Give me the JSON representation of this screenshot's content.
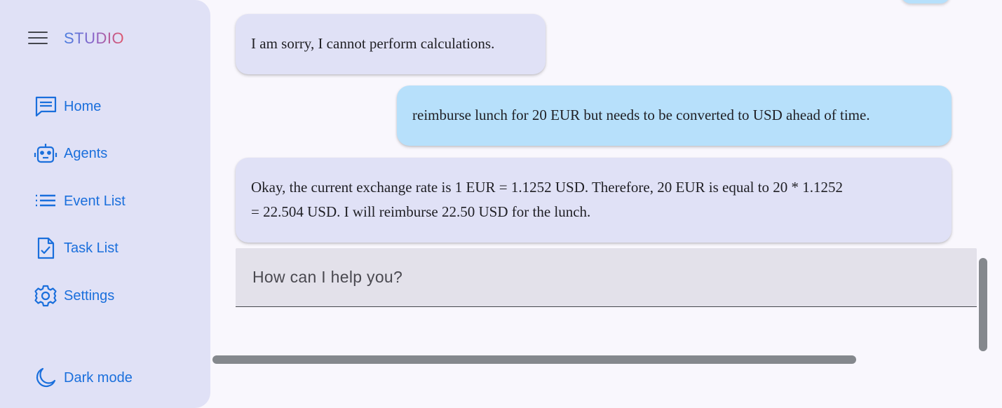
{
  "sidebar": {
    "brand": "STUDIO",
    "items": [
      {
        "label": "Home",
        "icon": "chat-icon"
      },
      {
        "label": "Agents",
        "icon": "robot-icon"
      },
      {
        "label": "Event List",
        "icon": "list-icon"
      },
      {
        "label": "Task List",
        "icon": "task-icon"
      },
      {
        "label": "Settings",
        "icon": "gear-icon"
      }
    ],
    "dark_mode": {
      "label": "Dark mode",
      "icon": "moon-icon"
    }
  },
  "chat": {
    "messages": [
      {
        "role": "bot",
        "text": "I am sorry, I cannot perform calculations."
      },
      {
        "role": "user",
        "text": "reimburse lunch for 20 EUR but needs to be converted to USD ahead of time."
      },
      {
        "role": "bot",
        "lines": [
          "Okay, the current exchange rate is 1 EUR = 1.1252 USD. Therefore, 20 EUR is equal to 20 * 1.1252",
          "= 22.504 USD. I will reimburse 22.50 USD for the lunch."
        ]
      }
    ],
    "input": {
      "placeholder": "How can I help you?",
      "value": ""
    }
  },
  "colors": {
    "sidebar_bg": "#e0e1f6",
    "accent": "#1a6fdc",
    "bot_bubble": "#e0e1f6",
    "user_bubble": "#b7e0fb",
    "page_bg": "#f9f7fd"
  }
}
